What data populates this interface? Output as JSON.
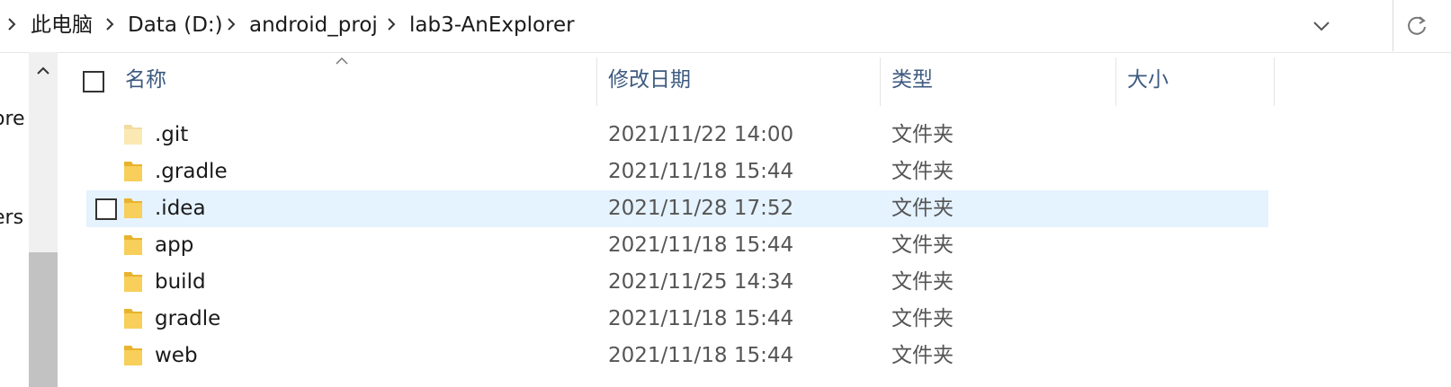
{
  "breadcrumb": {
    "items": [
      "此电脑",
      "Data (D:)",
      "android_proj",
      "lab3-AnExplorer"
    ]
  },
  "left_pane": {
    "labels": [
      "ore",
      "ers"
    ]
  },
  "columns": {
    "name": "名称",
    "modified": "修改日期",
    "type": "类型",
    "size": "大小"
  },
  "files": [
    {
      "name": ".git",
      "modified": "2021/11/22 14:00",
      "type": "文件夹",
      "size": "",
      "selected": false
    },
    {
      "name": ".gradle",
      "modified": "2021/11/18 15:44",
      "type": "文件夹",
      "size": "",
      "selected": false
    },
    {
      "name": ".idea",
      "modified": "2021/11/28 17:52",
      "type": "文件夹",
      "size": "",
      "selected": true
    },
    {
      "name": "app",
      "modified": "2021/11/18 15:44",
      "type": "文件夹",
      "size": "",
      "selected": false
    },
    {
      "name": "build",
      "modified": "2021/11/25 14:34",
      "type": "文件夹",
      "size": "",
      "selected": false
    },
    {
      "name": "gradle",
      "modified": "2021/11/18 15:44",
      "type": "文件夹",
      "size": "",
      "selected": false
    },
    {
      "name": "web",
      "modified": "2021/11/18 15:44",
      "type": "文件夹",
      "size": "",
      "selected": false
    }
  ],
  "icons": {
    "folder": "folder-icon",
    "refresh": "refresh-icon",
    "dropdown": "chevron-down-icon",
    "separator": "chevron-right-icon",
    "sort": "sort-up-icon"
  },
  "colors": {
    "selection": "#e5f3ff",
    "header_text": "#3d5a80",
    "folder": "#f5c443"
  }
}
